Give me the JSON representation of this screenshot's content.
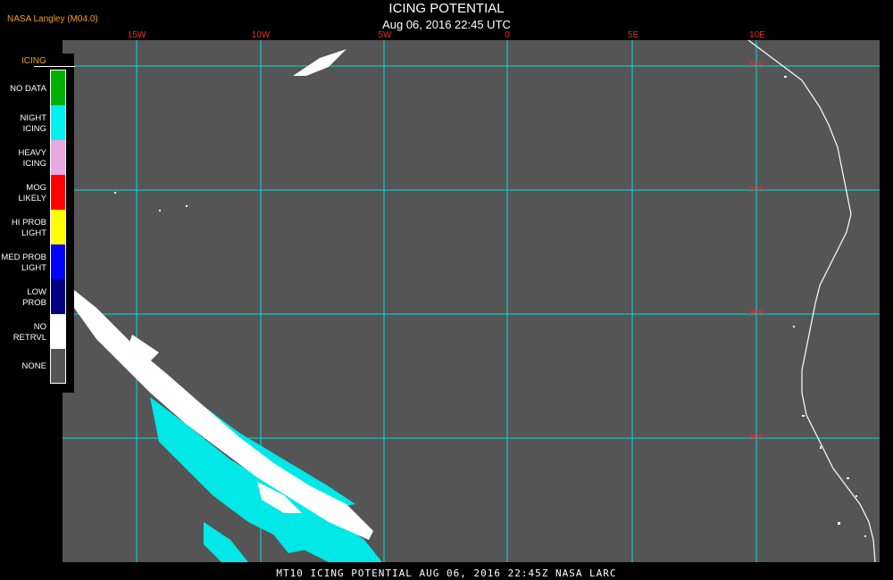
{
  "credit": "NASA Langley (M04.0)",
  "title": "ICING POTENTIAL",
  "subtitle": "Aug 06, 2016 22:45 UTC",
  "footer": "MT10   ICING POTENTIAL   AUG 06, 2016 22:45Z   NASA LARC",
  "map": {
    "background_color": "#555555",
    "grid_color": "#00e0e0",
    "label_color": "#e03030"
  },
  "longitude_labels": [
    "15W",
    "10W",
    "5W",
    "0",
    "5E",
    "10E"
  ],
  "latitude_labels": [
    "15S",
    "20S",
    "25S",
    "30S"
  ],
  "legend": {
    "title": "ICING",
    "items": [
      {
        "label": "NO DATA",
        "color": "#00b000"
      },
      {
        "label": "NIGHT ICING",
        "color": "#00f0f0"
      },
      {
        "label": "HEAVY ICING",
        "color": "#e8a8e0"
      },
      {
        "label": "MOG LIKELY",
        "color": "#ff0000"
      },
      {
        "label": "HI PROB LIGHT",
        "color": "#ffff00"
      },
      {
        "label": "MED PROB LIGHT",
        "color": "#0000ff"
      },
      {
        "label": "LOW PROB",
        "color": "#000080"
      },
      {
        "label": "NO RETRVL",
        "color": "#ffffff"
      },
      {
        "label": "NONE",
        "color": "#555555"
      }
    ]
  }
}
